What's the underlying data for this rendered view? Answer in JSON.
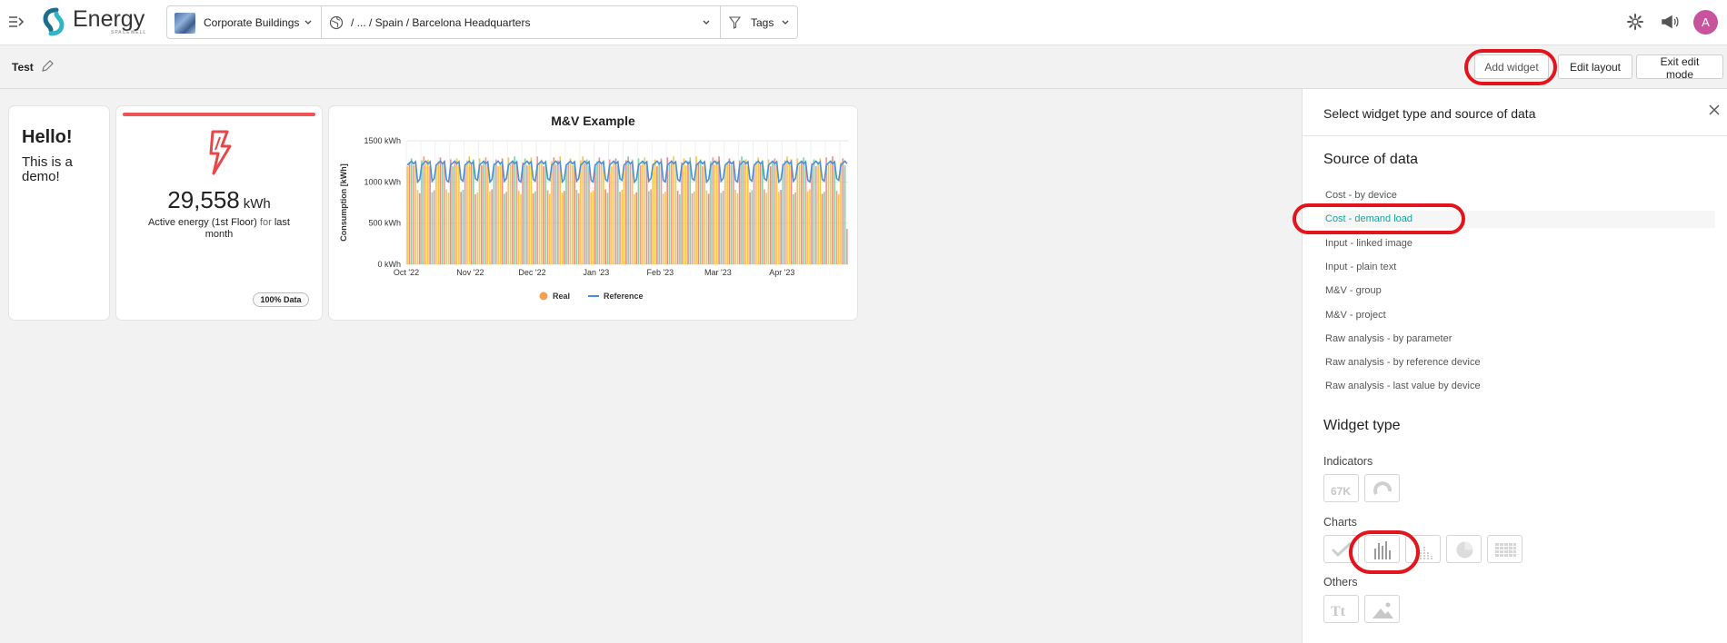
{
  "app": {
    "logo_text": "Energy",
    "logo_sub": "SPACEWELL"
  },
  "nav": {
    "building": "Corporate Buildings",
    "location": "/ ... / Spain / Barcelona Headquarters",
    "tags": "Tags",
    "avatar_initial": "A"
  },
  "toolbar": {
    "dashboard_title": "Test",
    "add_widget": "Add widget",
    "edit_layout": "Edit layout",
    "exit_edit_mode": "Exit edit mode"
  },
  "cards": {
    "hello": {
      "title": "Hello!",
      "body": "This is a demo!"
    },
    "energy": {
      "value": "29,558",
      "unit": "kWh",
      "desc_main": "Active energy (1st Floor)",
      "desc_for": "for",
      "desc_period": "last month",
      "badge": "100% Data",
      "accent": "#ef5454"
    },
    "mv": {
      "title": "M&V Example"
    }
  },
  "chart_data": {
    "type": "bar",
    "title": "M&V Example",
    "xlabel": "",
    "ylabel": "Consumption [kWh]",
    "ylim": [
      0,
      1500
    ],
    "yticks": [
      "0 kWh",
      "500 kWh",
      "1000 kWh",
      "1500 kWh"
    ],
    "xticks": [
      "Oct '22",
      "Nov '22",
      "Dec '22",
      "Jan '23",
      "Feb '23",
      "Mar '23",
      "Apr '23"
    ],
    "series": [
      {
        "name": "Real",
        "kind": "bar",
        "colors": [
          "#f5c84c",
          "#f29a9a",
          "#7fd7a2",
          "#f08a8a"
        ],
        "description_values_weekday_kwh": 1250,
        "description_values_weekend_kwh": 880
      },
      {
        "name": "Reference",
        "kind": "line",
        "color": "#4a90d9",
        "weekday_kwh": 1230,
        "weekend_kwh": 1000
      }
    ],
    "legend": "bottom",
    "grid": true
  },
  "panel": {
    "title": "Select widget type and source of data",
    "source_heading": "Source of data",
    "sources": [
      "Cost - by device",
      "Cost - demand load",
      "Input - linked image",
      "Input - plain text",
      "M&V - group",
      "M&V - project",
      "Raw analysis - by parameter",
      "Raw analysis - by reference device",
      "Raw analysis - last value by device"
    ],
    "active_source": "Cost - demand load",
    "widget_heading": "Widget type",
    "indicators_label": "Indicators",
    "indicator_tile_text": "67K",
    "charts_label": "Charts",
    "others_label": "Others",
    "others_text_tile": "Tt",
    "accent": "#12a89a"
  }
}
